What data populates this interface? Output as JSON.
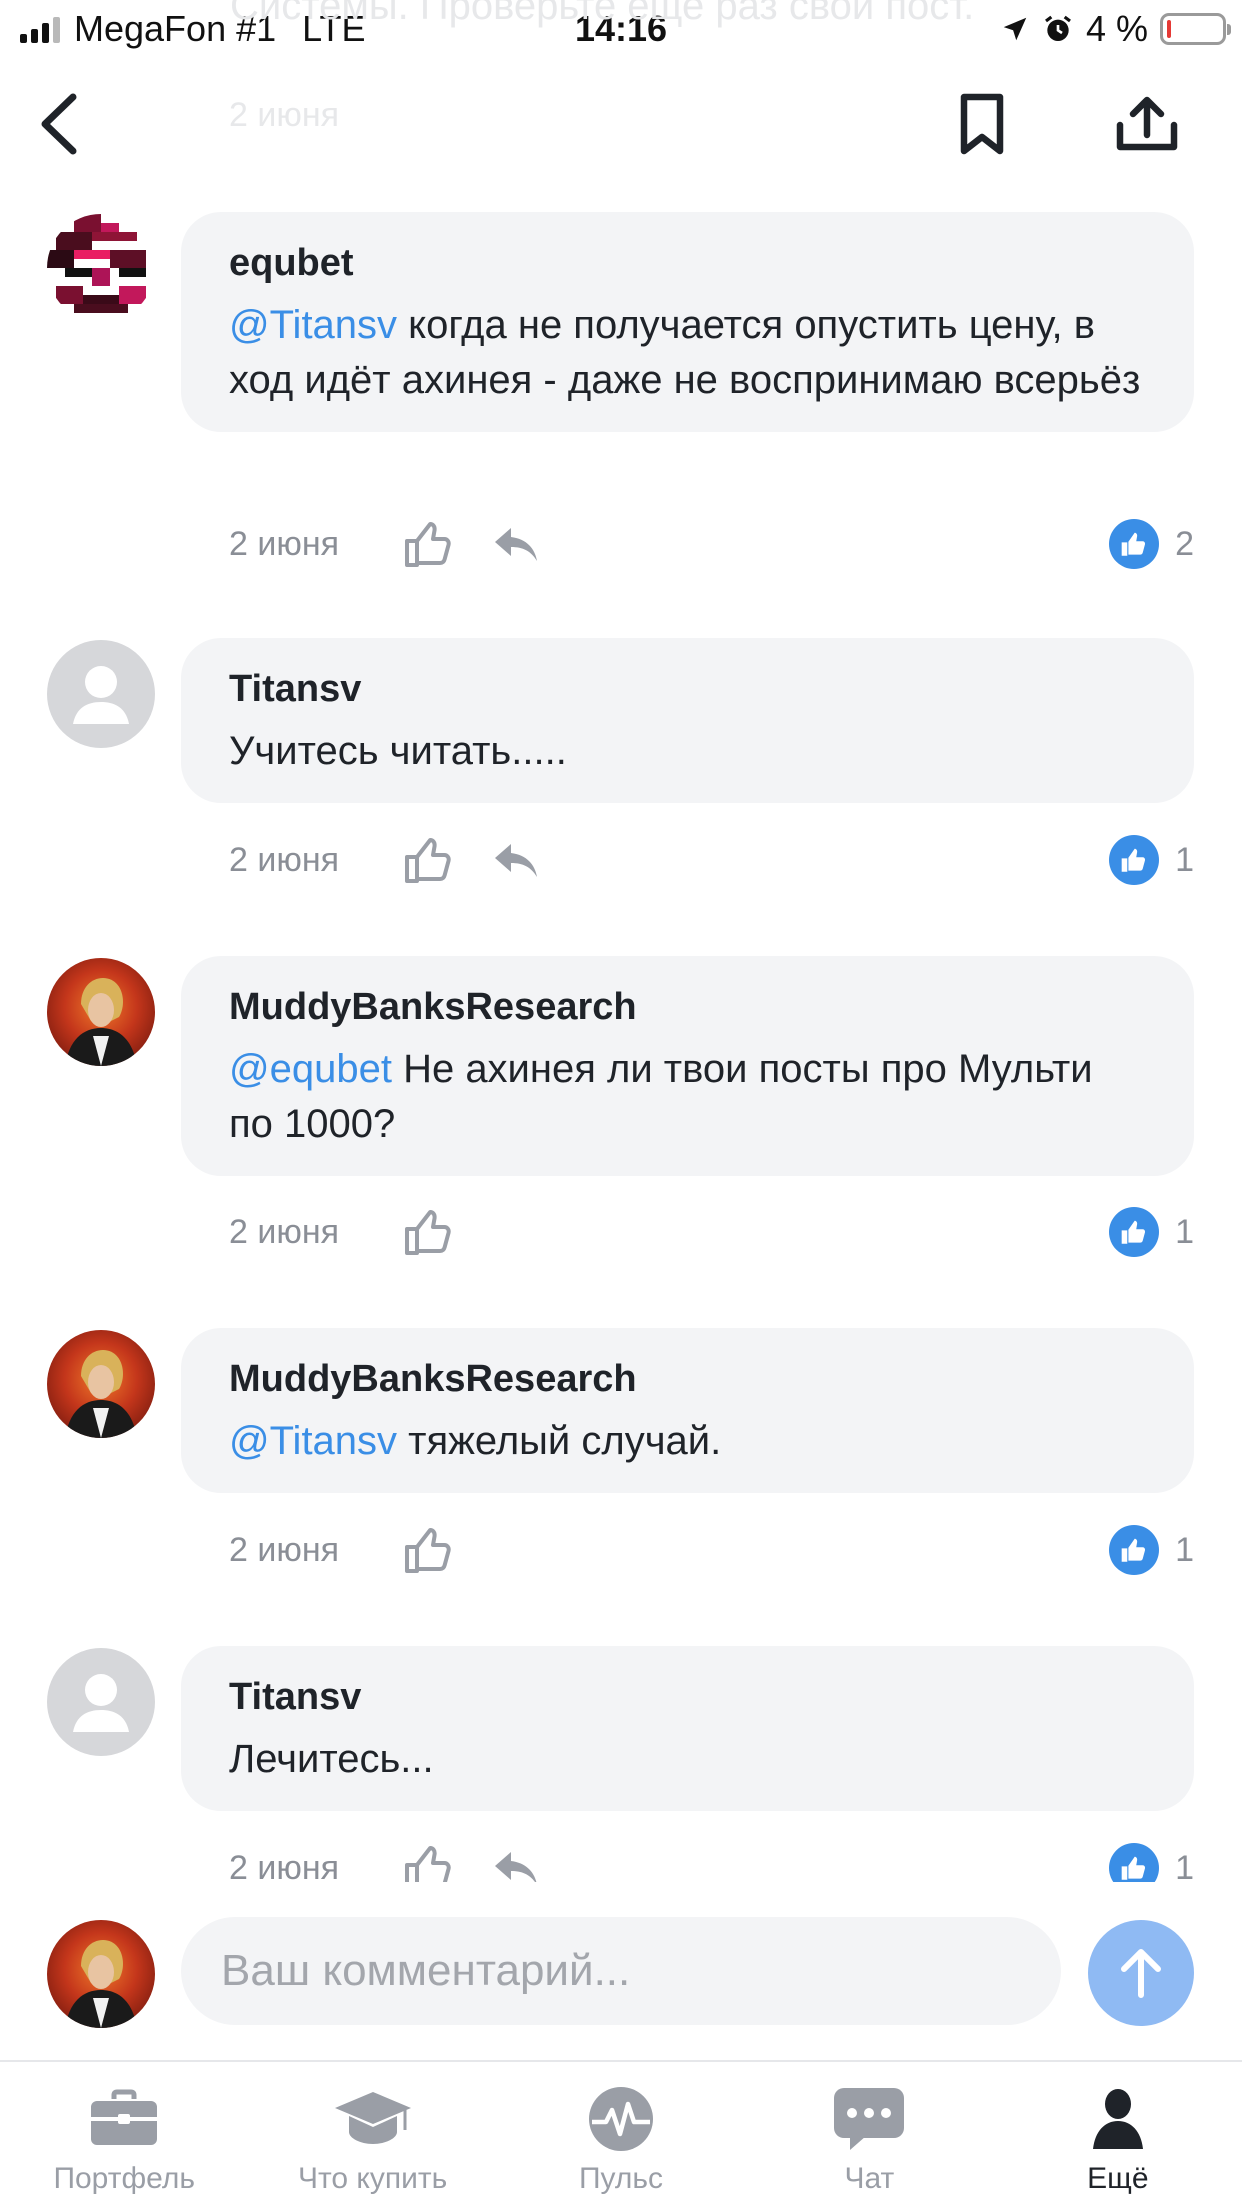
{
  "status_bar": {
    "carrier": "MegaFon #1",
    "network": "LTE",
    "time": "14:16",
    "battery": "4 %"
  },
  "background_text": {
    "line": "Системы. Проверьте еще раз свой пост.",
    "date": "2 июня"
  },
  "nav": {
    "back_icon": "chevron-left-icon",
    "bookmark_icon": "bookmark-icon",
    "share_icon": "share-icon"
  },
  "comments": [
    {
      "author": "equbet",
      "mention": "@Titansv",
      "text": " когда не получается опустить цену, в ход идёт ахинея - даже не воспринимаю всерьёз",
      "date": "2 июня",
      "likes": "2",
      "avatar": "pixel-avatar"
    },
    {
      "author": "Titansv",
      "mention": "",
      "text": "Учитесь читать.....",
      "date": "2 июня",
      "likes": "1",
      "avatar": "default-avatar"
    },
    {
      "author": "MuddyBanksResearch",
      "mention": "@equbet",
      "text": " Не ахинея ли твои посты про Мульти по 1000?",
      "date": "2 июня",
      "likes": "1",
      "avatar": "photo-avatar"
    },
    {
      "author": "MuddyBanksResearch",
      "mention": "@Titansv",
      "text": " тяжелый случай.",
      "date": "2 июня",
      "likes": "1",
      "avatar": "photo-avatar"
    },
    {
      "author": "Titansv",
      "mention": "",
      "text": "Лечитесь...",
      "date": "2 июня",
      "likes": "1",
      "avatar": "default-avatar"
    }
  ],
  "composer": {
    "placeholder": "Ваш комментарий...",
    "value": ""
  },
  "tabs": [
    {
      "label": "Портфель",
      "icon": "briefcase-icon",
      "active": false
    },
    {
      "label": "Что купить",
      "icon": "graduation-cap-icon",
      "active": false
    },
    {
      "label": "Пульс",
      "icon": "pulse-icon",
      "active": false
    },
    {
      "label": "Чат",
      "icon": "chat-icon",
      "active": false
    },
    {
      "label": "Ещё",
      "icon": "person-icon",
      "active": true
    }
  ],
  "colors": {
    "accent": "#3a8ee6",
    "send_button": "#8fbaf3",
    "bubble": "#f3f4f6",
    "muted": "#8a8e96"
  }
}
